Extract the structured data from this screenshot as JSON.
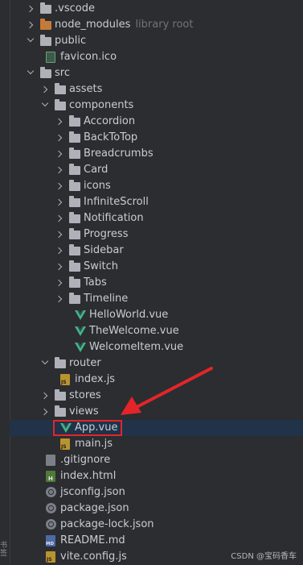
{
  "tree": [
    {
      "name": ".vscode",
      "type": "folder",
      "state": "closed",
      "depth": 1
    },
    {
      "name": "node_modules",
      "type": "folder-orange",
      "state": "closed",
      "depth": 1,
      "hint": "library root"
    },
    {
      "name": "public",
      "type": "folder",
      "state": "open",
      "depth": 1
    },
    {
      "name": "favicon.ico",
      "type": "ico",
      "depth": 2
    },
    {
      "name": "src",
      "type": "folder",
      "state": "open",
      "depth": 1
    },
    {
      "name": "assets",
      "type": "folder",
      "state": "closed",
      "depth": 2
    },
    {
      "name": "components",
      "type": "folder",
      "state": "open",
      "depth": 2
    },
    {
      "name": "Accordion",
      "type": "folder",
      "state": "closed",
      "depth": 3
    },
    {
      "name": "BackToTop",
      "type": "folder",
      "state": "closed",
      "depth": 3
    },
    {
      "name": "Breadcrumbs",
      "type": "folder",
      "state": "closed",
      "depth": 3
    },
    {
      "name": "Card",
      "type": "folder",
      "state": "closed",
      "depth": 3
    },
    {
      "name": "icons",
      "type": "folder",
      "state": "closed",
      "depth": 3
    },
    {
      "name": "InfiniteScroll",
      "type": "folder",
      "state": "closed",
      "depth": 3
    },
    {
      "name": "Notification",
      "type": "folder",
      "state": "closed",
      "depth": 3
    },
    {
      "name": "Progress",
      "type": "folder",
      "state": "closed",
      "depth": 3
    },
    {
      "name": "Sidebar",
      "type": "folder",
      "state": "closed",
      "depth": 3
    },
    {
      "name": "Switch",
      "type": "folder",
      "state": "closed",
      "depth": 3
    },
    {
      "name": "Tabs",
      "type": "folder",
      "state": "closed",
      "depth": 3
    },
    {
      "name": "Timeline",
      "type": "folder",
      "state": "closed",
      "depth": 3
    },
    {
      "name": "HelloWorld.vue",
      "type": "vue",
      "depth": 4
    },
    {
      "name": "TheWelcome.vue",
      "type": "vue",
      "depth": 4
    },
    {
      "name": "WelcomeItem.vue",
      "type": "vue",
      "depth": 4
    },
    {
      "name": "router",
      "type": "folder",
      "state": "open",
      "depth": 2
    },
    {
      "name": "index.js",
      "type": "js",
      "depth": 3
    },
    {
      "name": "stores",
      "type": "folder",
      "state": "closed",
      "depth": 2
    },
    {
      "name": "views",
      "type": "folder",
      "state": "closed",
      "depth": 2
    },
    {
      "name": "App.vue",
      "type": "vue",
      "depth": 3,
      "selected": true
    },
    {
      "name": "main.js",
      "type": "js",
      "depth": 3
    },
    {
      "name": ".gitignore",
      "type": "git",
      "depth": 2
    },
    {
      "name": "index.html",
      "type": "html",
      "depth": 2
    },
    {
      "name": "jsconfig.json",
      "type": "json",
      "depth": 2
    },
    {
      "name": "package.json",
      "type": "json",
      "depth": 2
    },
    {
      "name": "package-lock.json",
      "type": "json",
      "depth": 2
    },
    {
      "name": "README.md",
      "type": "md",
      "depth": 2
    },
    {
      "name": "vite.config.js",
      "type": "js",
      "depth": 2
    }
  ],
  "watermark": "CSDN @宝码香车",
  "side_label": "书签",
  "colors": {
    "background": "#2b2d30",
    "selected_row": "#203349",
    "annotation": "#e3252a",
    "vue": "#41b883"
  }
}
